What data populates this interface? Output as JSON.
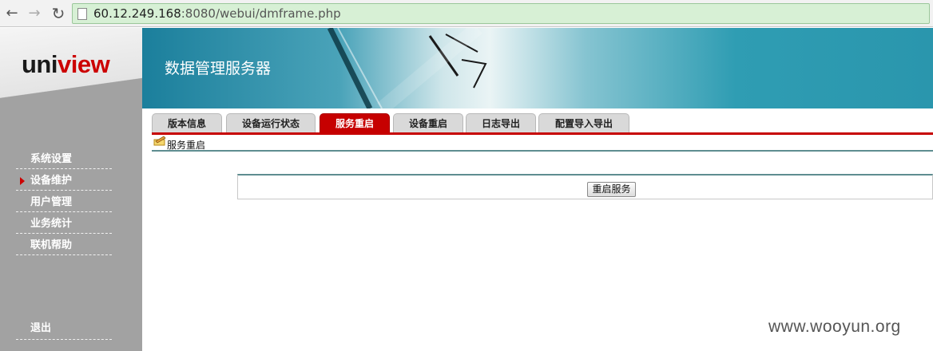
{
  "browser": {
    "url_host": "60.12.249.168",
    "url_rest": ":8080/webui/dmframe.php"
  },
  "logo": {
    "part1": "uni",
    "part2": "view"
  },
  "banner": {
    "title": "数据管理服务器"
  },
  "sidebar": {
    "items": [
      {
        "label": "系统设置"
      },
      {
        "label": "设备维护",
        "active": true
      },
      {
        "label": "用户管理"
      },
      {
        "label": "业务统计"
      },
      {
        "label": "联机帮助"
      }
    ],
    "exit_label": "退出"
  },
  "tabs": [
    {
      "label": "版本信息"
    },
    {
      "label": "设备运行状态"
    },
    {
      "label": "服务重启",
      "active": true
    },
    {
      "label": "设备重启"
    },
    {
      "label": "日志导出"
    },
    {
      "label": "配置导入导出"
    }
  ],
  "breadcrumb": {
    "label": "服务重启"
  },
  "content": {
    "restart_button": "重启服务"
  },
  "watermark": "www.wooyun.org",
  "colors": {
    "accent": "#c60000",
    "sidebar": "#a2a2a2",
    "banner": "#2a96ad"
  }
}
